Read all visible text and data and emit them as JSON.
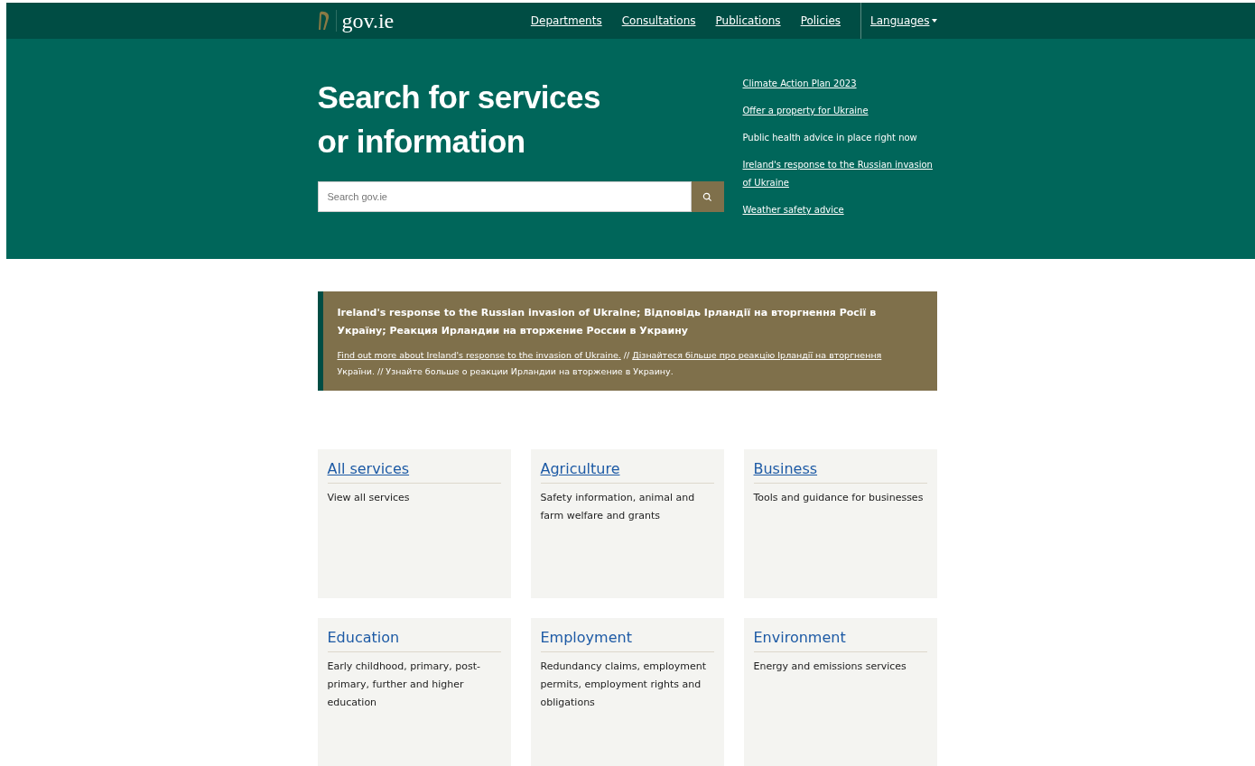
{
  "header": {
    "logo": "gov.ie",
    "nav": [
      {
        "label": "Departments"
      },
      {
        "label": "Consultations"
      },
      {
        "label": "Publications"
      },
      {
        "label": "Policies"
      }
    ],
    "languages": "Languages"
  },
  "hero": {
    "title_lines": [
      "Search for services",
      "or information"
    ],
    "search": {
      "placeholder": "Search gov.ie"
    },
    "quick_links": [
      {
        "kind": "link",
        "text": "Climate Action Plan 2023"
      },
      {
        "kind": "link",
        "text": "Offer a property for Ukraine"
      },
      {
        "kind": "text",
        "text": "Public health advice in place right now"
      },
      {
        "kind": "link",
        "text": "Ireland's response to the Russian invasion of Ukraine"
      },
      {
        "kind": "link",
        "text": "Weather safety advice"
      }
    ]
  },
  "notice": {
    "title": "Ireland's response to the Russian invasion of Ukraine; Відповідь Ірландії на вторгнення Росії в Україну; Реакция Ирландии на вторжение России в Украину",
    "parts": [
      {
        "kind": "link",
        "text": "Find out more about Ireland's response to the invasion of Ukraine."
      },
      {
        "kind": "text",
        "text": " // "
      },
      {
        "kind": "link",
        "text": "Дізнайтеся більше про реакцію Ірландії на вторгнення"
      },
      {
        "kind": "text",
        "text": " України. // Узнайте больше о реакции Ирландии на вторжение в Украину."
      }
    ]
  },
  "categories": [
    {
      "title": "All services",
      "description": "View all services"
    },
    {
      "title": "Agriculture",
      "description": "Safety information, animal and farm welfare and grants"
    },
    {
      "title": "Business",
      "description": "Tools and guidance for businesses"
    },
    {
      "title": "Education",
      "description": "Early childhood, primary, post-primary, further and higher education"
    },
    {
      "title": "Employment",
      "description": "Redundancy claims, employment permits, employment rights and obligations"
    },
    {
      "title": "Environment",
      "description": "Energy and emissions services"
    }
  ]
}
